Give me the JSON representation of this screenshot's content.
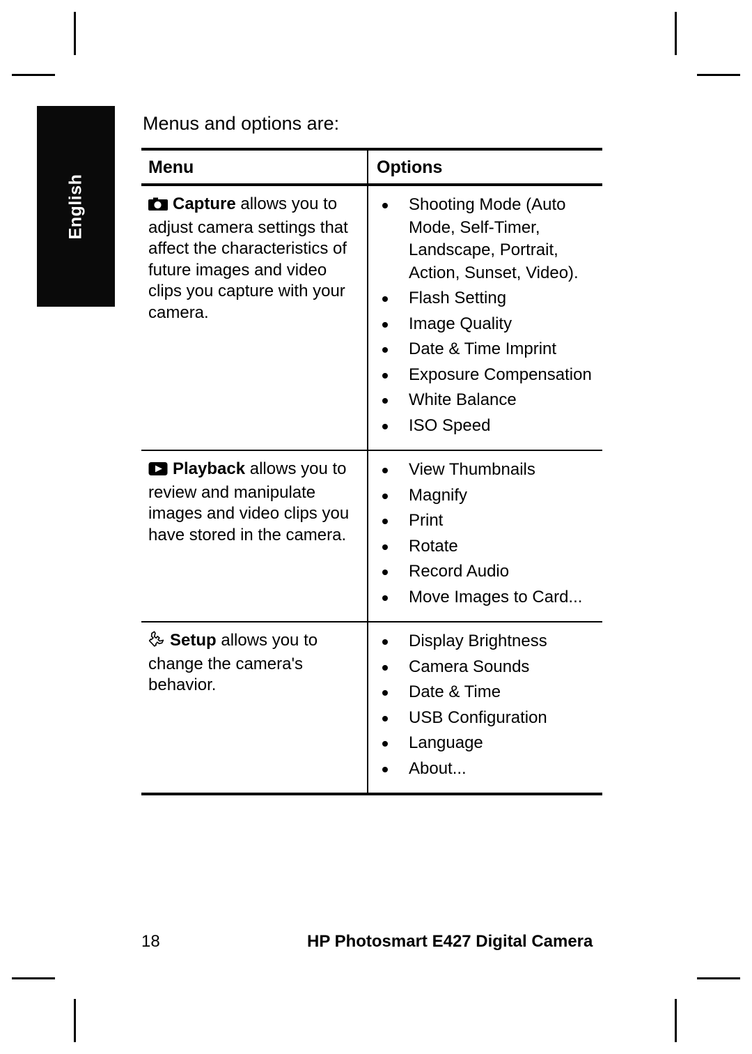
{
  "sidebar": {
    "language_tab": "English"
  },
  "page": {
    "intro": "Menus and options are:"
  },
  "table": {
    "headers": {
      "menu": "Menu",
      "options": "Options"
    },
    "rows": [
      {
        "icon": "camera-icon",
        "menu_name": "Capture",
        "menu_description": " allows you to adjust camera settings that affect the characteristics of future images and video clips you capture with your camera.",
        "options": [
          "Shooting Mode (Auto Mode, Self-Timer, Landscape, Portrait, Action, Sunset, Video).",
          "Flash Setting",
          "Image Quality",
          "Date & Time Imprint",
          "Exposure Compensation",
          "White Balance",
          "ISO Speed"
        ]
      },
      {
        "icon": "play-icon",
        "menu_name": "Playback",
        "menu_description": " allows you to review and manipulate images and video clips you have stored in the camera.",
        "options": [
          "View Thumbnails",
          "Magnify",
          "Print",
          "Rotate",
          "Record Audio",
          "Move Images to Card..."
        ]
      },
      {
        "icon": "wrench-icon",
        "menu_name": "Setup",
        "menu_description": " allows you to change the camera's behavior.",
        "options": [
          "Display Brightness",
          "Camera Sounds",
          "Date & Time",
          "USB Configuration",
          "Language",
          "About..."
        ]
      }
    ]
  },
  "footer": {
    "page_number": "18",
    "document_title": "HP Photosmart E427 Digital Camera"
  },
  "colors": {
    "text": "#000000",
    "background": "#ffffff",
    "tab_background": "#0a0a0a",
    "tab_text": "#ffffff"
  }
}
